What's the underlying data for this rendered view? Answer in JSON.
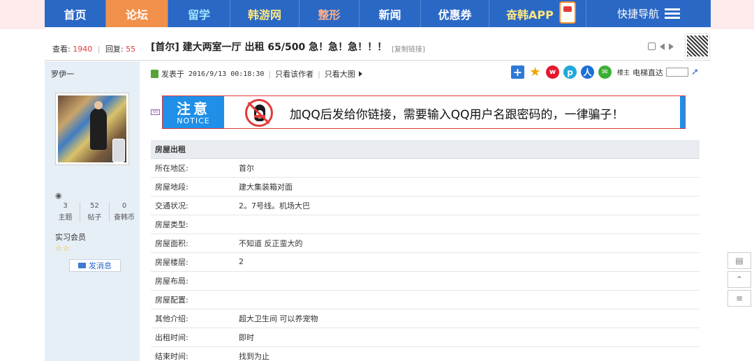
{
  "nav": {
    "items": [
      "首页",
      "论坛",
      "留学",
      "韩游网",
      "整形",
      "新闻",
      "优惠券",
      "奋韩APP"
    ],
    "quick_nav": "快捷导航"
  },
  "thread": {
    "views_label": "查看:",
    "views": "1940",
    "replies_label": "回复:",
    "replies": "55",
    "title": "[首尔] 建大两室一厅 出租 65/500 急！急！急！！！",
    "copy_link": "[复制链接]"
  },
  "author": {
    "name": "罗伊一",
    "stats": [
      {
        "value": "3",
        "label": "主题"
      },
      {
        "value": "52",
        "label": "帖子"
      },
      {
        "value": "0",
        "label": "奋韩币"
      }
    ],
    "rank": "实习会员",
    "stars": "☆☆",
    "pm_label": "发消息"
  },
  "post": {
    "posted_label": "发表于",
    "posted_time": "2016/9/13 00:18:30",
    "only_author": "只看该作者",
    "big_image": "只看大图",
    "floor_small": "楼主",
    "elevator": "电梯直达"
  },
  "notice": {
    "zh": "注意",
    "en": "NOTICE",
    "message": "加QQ后发给你链接，需要输入QQ用户名跟密码的，一律骗子！"
  },
  "table": {
    "header": "房屋出租",
    "rows": [
      {
        "label": "所在地区:",
        "value": "首尔"
      },
      {
        "label": "房屋地段:",
        "value": "建大集装箱对面"
      },
      {
        "label": "交通状况:",
        "value": "2。7号线。机场大巴"
      },
      {
        "label": "房屋类型:",
        "value": ""
      },
      {
        "label": "房屋面积:",
        "value": "不知道 反正蛮大的"
      },
      {
        "label": "房屋楼层:",
        "value": "2"
      },
      {
        "label": "房屋布局:",
        "value": ""
      },
      {
        "label": "房屋配置:",
        "value": ""
      },
      {
        "label": "其他介绍:",
        "value": "超大卫生间 可以养宠物"
      },
      {
        "label": "出租时间:",
        "value": "即时"
      },
      {
        "label": "结束时间:",
        "value": "找到为止"
      }
    ]
  },
  "colors": {
    "nav_blue": "#2a68c6",
    "nav_active": "#f0904a",
    "notice_blue": "#1f8fe8",
    "alert_red": "#e23a3a"
  }
}
